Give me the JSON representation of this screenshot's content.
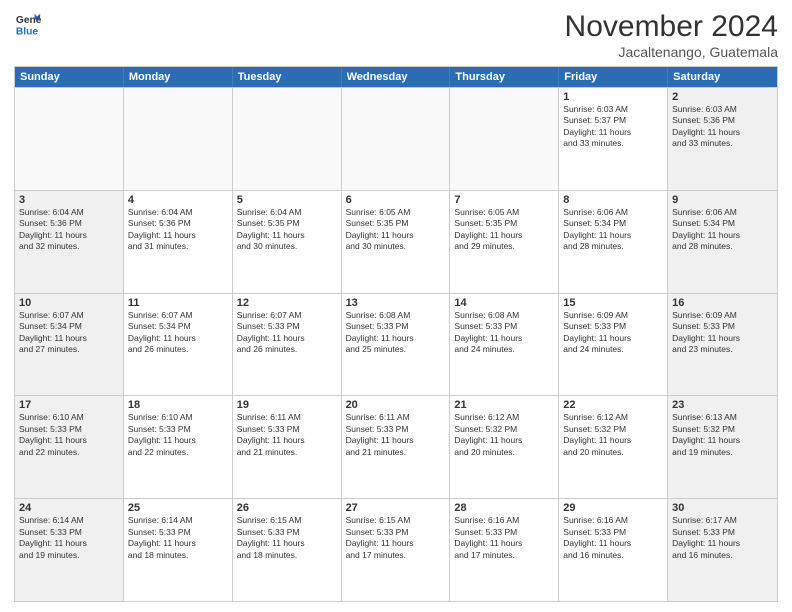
{
  "header": {
    "logo_general": "General",
    "logo_blue": "Blue",
    "month_title": "November 2024",
    "location": "Jacaltenango, Guatemala"
  },
  "weekdays": [
    "Sunday",
    "Monday",
    "Tuesday",
    "Wednesday",
    "Thursday",
    "Friday",
    "Saturday"
  ],
  "weeks": [
    [
      {
        "day": "",
        "info": ""
      },
      {
        "day": "",
        "info": ""
      },
      {
        "day": "",
        "info": ""
      },
      {
        "day": "",
        "info": ""
      },
      {
        "day": "",
        "info": ""
      },
      {
        "day": "1",
        "info": "Sunrise: 6:03 AM\nSunset: 5:37 PM\nDaylight: 11 hours\nand 33 minutes."
      },
      {
        "day": "2",
        "info": "Sunrise: 6:03 AM\nSunset: 5:36 PM\nDaylight: 11 hours\nand 33 minutes."
      }
    ],
    [
      {
        "day": "3",
        "info": "Sunrise: 6:04 AM\nSunset: 5:36 PM\nDaylight: 11 hours\nand 32 minutes."
      },
      {
        "day": "4",
        "info": "Sunrise: 6:04 AM\nSunset: 5:36 PM\nDaylight: 11 hours\nand 31 minutes."
      },
      {
        "day": "5",
        "info": "Sunrise: 6:04 AM\nSunset: 5:35 PM\nDaylight: 11 hours\nand 30 minutes."
      },
      {
        "day": "6",
        "info": "Sunrise: 6:05 AM\nSunset: 5:35 PM\nDaylight: 11 hours\nand 30 minutes."
      },
      {
        "day": "7",
        "info": "Sunrise: 6:05 AM\nSunset: 5:35 PM\nDaylight: 11 hours\nand 29 minutes."
      },
      {
        "day": "8",
        "info": "Sunrise: 6:06 AM\nSunset: 5:34 PM\nDaylight: 11 hours\nand 28 minutes."
      },
      {
        "day": "9",
        "info": "Sunrise: 6:06 AM\nSunset: 5:34 PM\nDaylight: 11 hours\nand 28 minutes."
      }
    ],
    [
      {
        "day": "10",
        "info": "Sunrise: 6:07 AM\nSunset: 5:34 PM\nDaylight: 11 hours\nand 27 minutes."
      },
      {
        "day": "11",
        "info": "Sunrise: 6:07 AM\nSunset: 5:34 PM\nDaylight: 11 hours\nand 26 minutes."
      },
      {
        "day": "12",
        "info": "Sunrise: 6:07 AM\nSunset: 5:33 PM\nDaylight: 11 hours\nand 26 minutes."
      },
      {
        "day": "13",
        "info": "Sunrise: 6:08 AM\nSunset: 5:33 PM\nDaylight: 11 hours\nand 25 minutes."
      },
      {
        "day": "14",
        "info": "Sunrise: 6:08 AM\nSunset: 5:33 PM\nDaylight: 11 hours\nand 24 minutes."
      },
      {
        "day": "15",
        "info": "Sunrise: 6:09 AM\nSunset: 5:33 PM\nDaylight: 11 hours\nand 24 minutes."
      },
      {
        "day": "16",
        "info": "Sunrise: 6:09 AM\nSunset: 5:33 PM\nDaylight: 11 hours\nand 23 minutes."
      }
    ],
    [
      {
        "day": "17",
        "info": "Sunrise: 6:10 AM\nSunset: 5:33 PM\nDaylight: 11 hours\nand 22 minutes."
      },
      {
        "day": "18",
        "info": "Sunrise: 6:10 AM\nSunset: 5:33 PM\nDaylight: 11 hours\nand 22 minutes."
      },
      {
        "day": "19",
        "info": "Sunrise: 6:11 AM\nSunset: 5:33 PM\nDaylight: 11 hours\nand 21 minutes."
      },
      {
        "day": "20",
        "info": "Sunrise: 6:11 AM\nSunset: 5:33 PM\nDaylight: 11 hours\nand 21 minutes."
      },
      {
        "day": "21",
        "info": "Sunrise: 6:12 AM\nSunset: 5:32 PM\nDaylight: 11 hours\nand 20 minutes."
      },
      {
        "day": "22",
        "info": "Sunrise: 6:12 AM\nSunset: 5:32 PM\nDaylight: 11 hours\nand 20 minutes."
      },
      {
        "day": "23",
        "info": "Sunrise: 6:13 AM\nSunset: 5:32 PM\nDaylight: 11 hours\nand 19 minutes."
      }
    ],
    [
      {
        "day": "24",
        "info": "Sunrise: 6:14 AM\nSunset: 5:33 PM\nDaylight: 11 hours\nand 19 minutes."
      },
      {
        "day": "25",
        "info": "Sunrise: 6:14 AM\nSunset: 5:33 PM\nDaylight: 11 hours\nand 18 minutes."
      },
      {
        "day": "26",
        "info": "Sunrise: 6:15 AM\nSunset: 5:33 PM\nDaylight: 11 hours\nand 18 minutes."
      },
      {
        "day": "27",
        "info": "Sunrise: 6:15 AM\nSunset: 5:33 PM\nDaylight: 11 hours\nand 17 minutes."
      },
      {
        "day": "28",
        "info": "Sunrise: 6:16 AM\nSunset: 5:33 PM\nDaylight: 11 hours\nand 17 minutes."
      },
      {
        "day": "29",
        "info": "Sunrise: 6:16 AM\nSunset: 5:33 PM\nDaylight: 11 hours\nand 16 minutes."
      },
      {
        "day": "30",
        "info": "Sunrise: 6:17 AM\nSunset: 5:33 PM\nDaylight: 11 hours\nand 16 minutes."
      }
    ]
  ]
}
